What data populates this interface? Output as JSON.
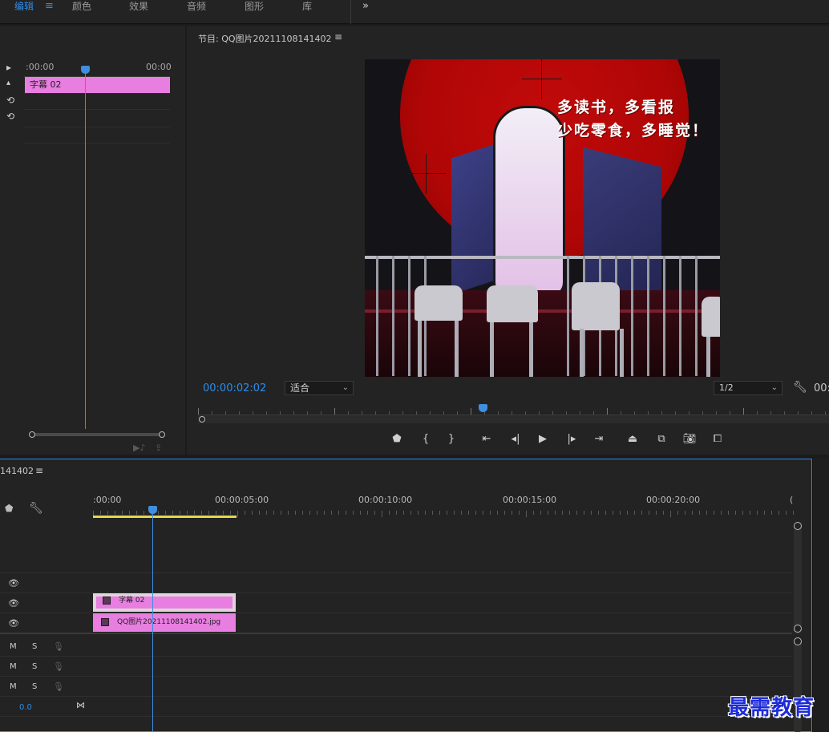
{
  "workspaces": [
    "编辑",
    "颜色",
    "效果",
    "音频",
    "图形",
    "库"
  ],
  "workspace_active": "编辑",
  "workspace_menu": "≡",
  "more_panels": "»",
  "source": {
    "timecode_left": ":00:00",
    "timecode_right": "00:00",
    "clip_label": "字幕 02"
  },
  "program": {
    "title": "节目: QQ图片20211108141402",
    "menu": "≡",
    "slogan_line1": "多读书，多看报",
    "slogan_line2": "少吃零食，多睡觉！",
    "timecode": "00:00:02:02",
    "fit_value": "适合",
    "resolution_value": "1/2",
    "timecode_end": "00:"
  },
  "timeline": {
    "title": "141402",
    "menu": "≡",
    "ruler_labels": [
      ":00:00",
      "00:00:05:00",
      "00:00:10:00",
      "00:00:15:00",
      "00:00:20:00",
      "("
    ],
    "clip_title": "字幕 02",
    "clip_image": "QQ图片20211108141402.jpg",
    "audio_m": "M",
    "audio_s": "S",
    "volume": "0.0"
  },
  "watermark": "最需教育",
  "colors": {
    "accent": "#2d8ceb",
    "clip": "#e87ee0",
    "workarea": "#e5d64e"
  }
}
